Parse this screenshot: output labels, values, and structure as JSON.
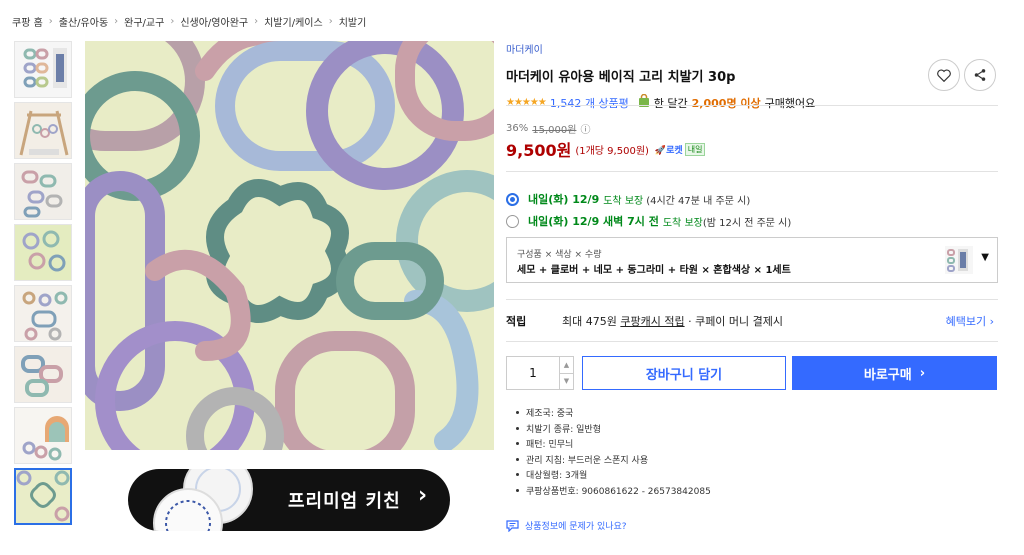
{
  "breadcrumb": [
    "쿠팡 홈",
    "출산/유아동",
    "완구/교구",
    "신생아/영아완구",
    "치발기/케이스",
    "치발기"
  ],
  "colors": {
    "accent": "#346aff",
    "price": "#ae0000",
    "delivery_green": "#00891a",
    "star": "#f5a623"
  },
  "banner": {
    "text": "프리미엄 키친",
    "arrow": "›"
  },
  "product": {
    "brand": "마더케이",
    "title": "마더케이 유아용 베이직 고리 치발기 30p",
    "stars": "★★★★★",
    "rating": 5,
    "review_count": "1,542 개 상품평",
    "purchase_prefix": "한 달간",
    "purchase_count": "2,000명 이상",
    "purchase_suffix": "구매했어요",
    "discount_rate": "36%",
    "original_price": "15,000원",
    "info_icon": "ⓘ",
    "price": "9,500원",
    "unit_price": "(1개당 9,500원)",
    "rocket_label": "로켓",
    "tomorrow_label": "내일"
  },
  "actions": {
    "wishlist_icon": "heart-icon",
    "share_icon": "share-icon"
  },
  "delivery": [
    {
      "selected": true,
      "date": "내일(화) 12/9",
      "guarantee": "도착 보장",
      "note": "(4시간 47분 내 주문 시)"
    },
    {
      "selected": false,
      "date": "내일(화) 12/9 새벽 7시 전",
      "guarantee": "도착 보장",
      "note": "(밤 12시 전 주문 시)"
    }
  ],
  "option": {
    "label": "구성품 × 색상 × 수량",
    "value": "세모 + 클로버 + 네모 + 동그라미 + 타원 × 혼합색상 × 1세트"
  },
  "points": {
    "label": "적립",
    "prefix": "최대 475원",
    "link": "쿠팡캐시 적립",
    "suffix": "· 쿠페이 머니 결제시",
    "more": "혜택보기 ›"
  },
  "quantity": {
    "value": "1"
  },
  "buttons": {
    "cart": "장바구니 담기",
    "buy": "바로구매",
    "buy_arrow": "›"
  },
  "attributes": [
    "제조국: 중국",
    "치발기 종류: 일반형",
    "패턴: 민무늬",
    "관리 지침: 부드러운 스폰지 사용",
    "대상월령: 3개월",
    "쿠팡상품번호: 9060861622 - 26573842085"
  ],
  "report": {
    "text": "상품정보에 문제가 있나요?"
  }
}
